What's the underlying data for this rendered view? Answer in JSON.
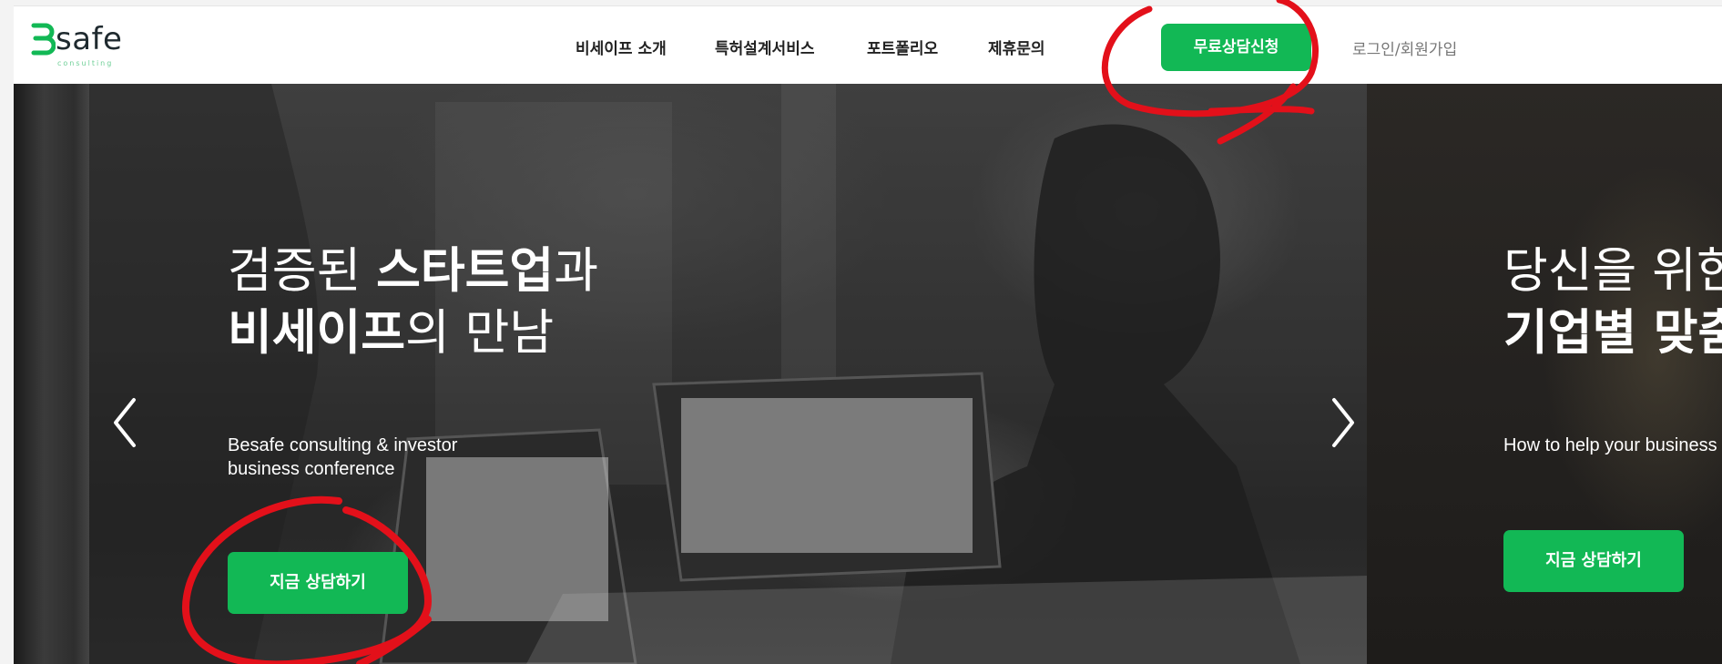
{
  "brand": {
    "logo_text": "safe",
    "logo_sub": "consulting",
    "accent_color": "#12b855"
  },
  "nav": {
    "items": [
      "비세이프 소개",
      "특허설계서비스",
      "포트폴리오",
      "제휴문의"
    ],
    "cta": "무료상담신청",
    "login": "로그인/회원가입"
  },
  "hero": {
    "slide1": {
      "title_line1_light": "검증된 ",
      "title_line1_bold": "스타트업",
      "title_line1_tail": "과",
      "title_line2_bold": "비세이프",
      "title_line2_light": "의 만남",
      "subtitle_line1": "Besafe consulting & investor",
      "subtitle_line2": "business conference",
      "button": "지금 상담하기"
    },
    "slide2": {
      "title_line1": "당신을 위한",
      "title_line2": "기업별 맞춤",
      "subtitle": "How to help your business",
      "button": "지금 상담하기"
    },
    "prev_icon": "chevron-left-icon",
    "next_icon": "chevron-right-icon"
  },
  "annotation_color": "#e3101a"
}
